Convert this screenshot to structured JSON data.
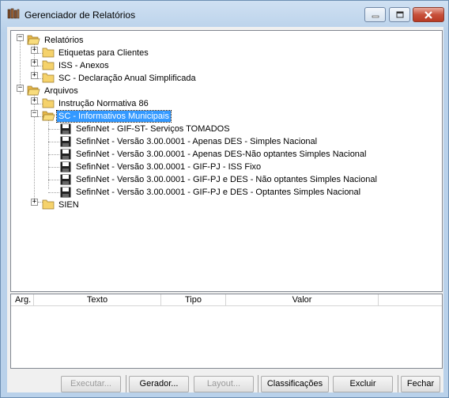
{
  "window": {
    "title": "Gerenciador de Relatórios"
  },
  "tree": {
    "roots": [
      {
        "label": "Relatórios",
        "expanded": true,
        "children": [
          {
            "label": "Etiquetas para Clientes",
            "expanded": false
          },
          {
            "label": "ISS - Anexos",
            "expanded": false
          },
          {
            "label": "SC - Declaração Anual Simplificada",
            "expanded": false
          }
        ]
      },
      {
        "label": "Arquivos",
        "expanded": true,
        "children": [
          {
            "label": "Instrução Normativa 86",
            "expanded": false
          },
          {
            "label": "SC - Informativos Municipais",
            "expanded": true,
            "selected": true,
            "children": [
              {
                "label": "SefinNet - GIF-ST- Serviços TOMADOS"
              },
              {
                "label": "SefinNet - Versão 3.00.0001 - Apenas DES - Simples Nacional"
              },
              {
                "label": "SefinNet - Versão 3.00.0001 - Apenas DES-Não optantes Simples Nacional"
              },
              {
                "label": "SefinNet - Versão 3.00.0001 - GIF-PJ - ISS Fixo"
              },
              {
                "label": "SefinNet - Versão 3.00.0001 - GIF-PJ e DES - Não optantes Simples Nacional"
              },
              {
                "label": "SefinNet - Versão 3.00.0001 - GIF-PJ e DES - Optantes Simples Nacional"
              }
            ]
          },
          {
            "label": "SIEN",
            "expanded": false
          }
        ]
      }
    ]
  },
  "grid": {
    "columns": [
      "Arg.",
      "Texto",
      "Tipo",
      "Valor"
    ]
  },
  "buttons": {
    "executar": "Executar...",
    "gerador": "Gerador...",
    "layout": "Layout...",
    "classificacoes": "Classificações",
    "excluir": "Excluir",
    "fechar": "Fechar"
  },
  "colors": {
    "selection": "#3399ff",
    "folder": "#f5d26b",
    "window_frame": "#b9d1ea"
  }
}
